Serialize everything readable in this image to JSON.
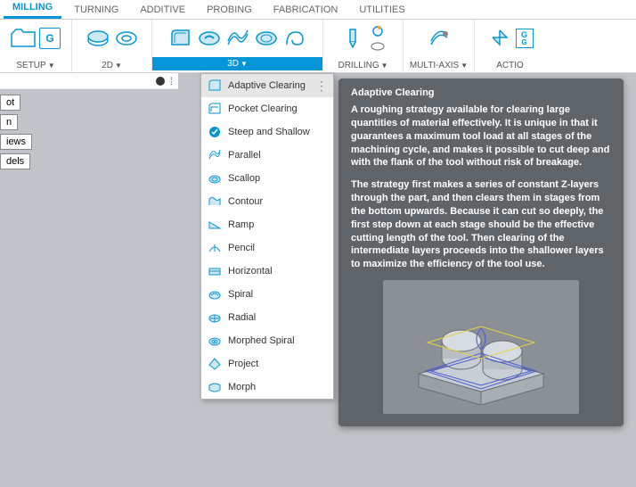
{
  "tabs": [
    "MILLING",
    "TURNING",
    "ADDITIVE",
    "PROBING",
    "FABRICATION",
    "UTILITIES"
  ],
  "active_tab": 0,
  "ribbon": {
    "setup": {
      "label": "SETUP"
    },
    "twod": {
      "label": "2D"
    },
    "threed": {
      "label": "3D"
    },
    "drilling": {
      "label": "DRILLING"
    },
    "multiaxis": {
      "label": "MULTI-AXIS"
    },
    "actions": {
      "label": "ACTIO"
    }
  },
  "browser_items": [
    "ot",
    "n",
    "iews",
    "dels"
  ],
  "dropdown": [
    {
      "icon": "adaptive",
      "label": "Adaptive Clearing",
      "hover": true,
      "dots": true
    },
    {
      "icon": "pocket",
      "label": "Pocket Clearing"
    },
    {
      "icon": "steep",
      "label": "Steep and Shallow"
    },
    {
      "icon": "parallel",
      "label": "Parallel"
    },
    {
      "icon": "scallop",
      "label": "Scallop"
    },
    {
      "icon": "contour",
      "label": "Contour"
    },
    {
      "icon": "ramp",
      "label": "Ramp"
    },
    {
      "icon": "pencil",
      "label": "Pencil"
    },
    {
      "icon": "horizontal",
      "label": "Horizontal"
    },
    {
      "icon": "spiral",
      "label": "Spiral"
    },
    {
      "icon": "radial",
      "label": "Radial"
    },
    {
      "icon": "morphed",
      "label": "Morphed Spiral"
    },
    {
      "icon": "project",
      "label": "Project"
    },
    {
      "icon": "morph",
      "label": "Morph"
    }
  ],
  "tooltip": {
    "title": "Adaptive Clearing",
    "p1": "A roughing strategy available for clearing large quantities of material effectively. It is unique in that it guarantees a maximum tool load at all stages of the machining cycle, and makes it possible to cut deep and with the flank of the tool without risk of breakage.",
    "p2": "The strategy first makes a series of constant Z-layers through the part, and then clears them in stages from the bottom upwards. Because it can cut so deeply, the first step down at each stage should be the effective cutting length of the tool. Then clearing of the intermediate layers proceeds into the shallower layers to maximize the efficiency of the tool use."
  }
}
